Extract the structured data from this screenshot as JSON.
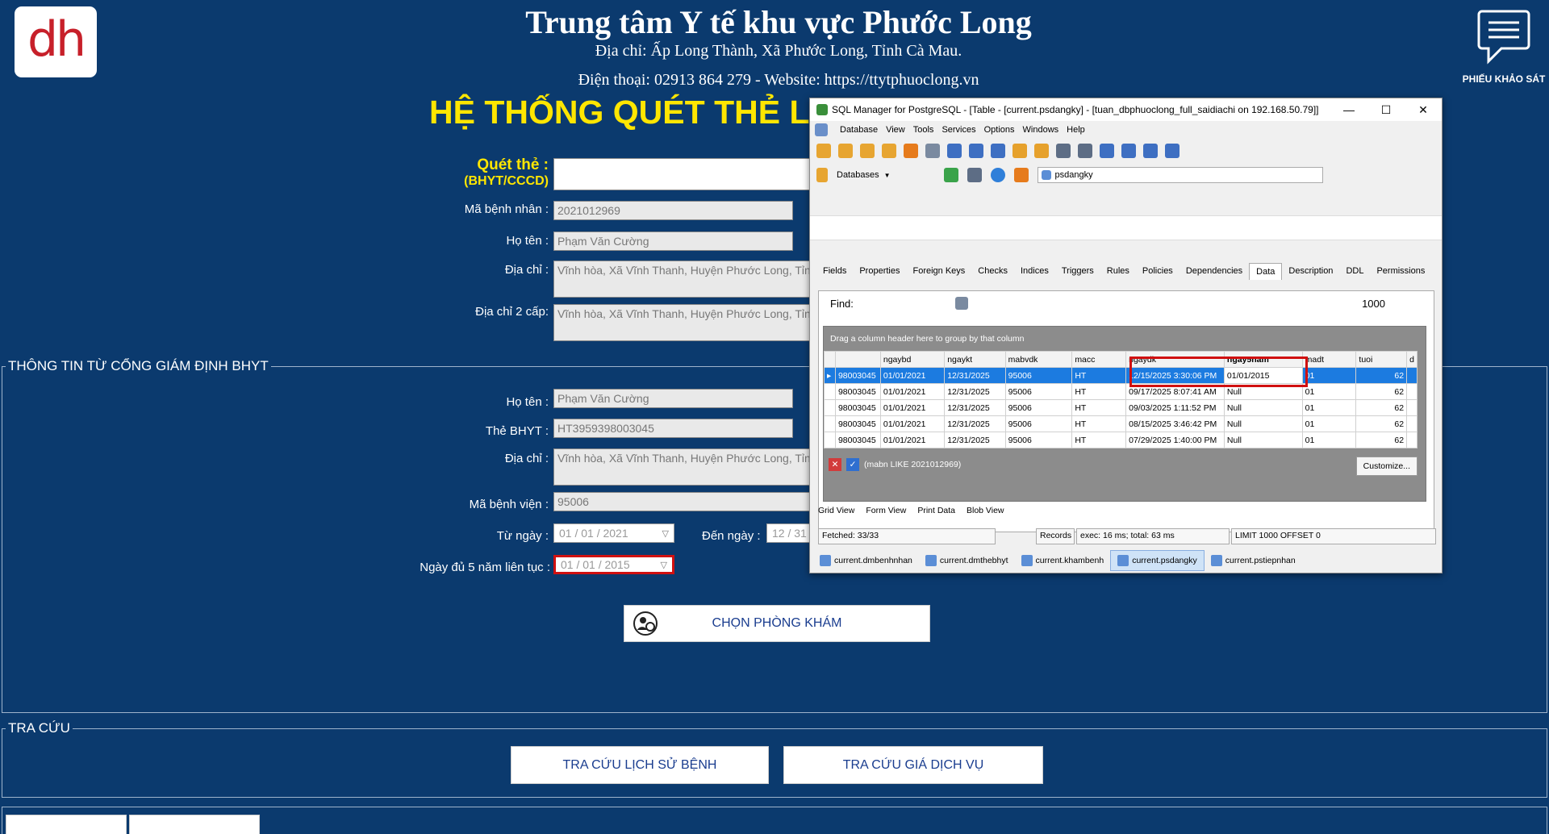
{
  "header": {
    "logo": "dh",
    "title": "Trung tâm Y tế khu vực Phước Long",
    "address": "Địa chỉ: Ấp Long Thành, Xã Phước Long, Tỉnh Cà Mau.",
    "phone": "Điện thoại: 02913 864 279 - Website: https://ttytphuoclong.vn",
    "system_title": "HỆ THỐNG QUÉT THẺ L",
    "survey": "PHIẾU KHẢO SÁT"
  },
  "form": {
    "scan_label": "Quét thẻ :",
    "scan_sub": "(BHYT/CCCD)",
    "scan_value": "",
    "patient_id_label": "Mã bệnh nhân :",
    "patient_id": "2021012969",
    "name_label": "Họ tên :",
    "name": "Phạm Văn Cường",
    "address_label": "Địa chỉ :",
    "address": "Vĩnh hòa, Xã Vĩnh Thanh, Huyện Phước Long, Tỉnh Bạ",
    "address2_label": "Địa chỉ 2 cấp:",
    "address2": "Vĩnh hòa, Xã Vĩnh Thanh, Huyện Phước Long, Tỉnh Bạ"
  },
  "bhyt": {
    "legend": "THÔNG TIN TỪ CỔNG GIÁM ĐỊNH BHYT",
    "name_label": "Họ tên :",
    "name": "Phạm Văn Cường",
    "card_label": "Thẻ BHYT :",
    "card": "HT3959398003045",
    "address_label": "Địa chỉ :",
    "address": "Vĩnh hòa, Xã Vĩnh Thanh, Huyện Phước Long, Tỉnh Bạ",
    "hospital_label": "Mã bệnh viện :",
    "hospital": "95006",
    "from_label": "Từ  ngày :",
    "from": "01 / 01 / 2021",
    "to_label": "Đến ngày :",
    "to": "12 / 31",
    "five_label": "Ngày đủ 5 năm liên tục :",
    "five": "01 / 01 / 2015",
    "choose_btn": "CHỌN PHÒNG KHÁM"
  },
  "lookup": {
    "legend": "TRA CỨU",
    "history_btn": "TRA CỨU LỊCH SỬ BỆNH",
    "price_btn": "TRA CỨU GIÁ DỊCH VỤ"
  },
  "sqlwin": {
    "title": "SQL Manager for PostgreSQL - [Table - [current.psdangky] - [tuan_dbphuoclong_full_saidiachi on 192.168.50.79]]",
    "menu": [
      "Database",
      "View",
      "Tools",
      "Services",
      "Options",
      "Windows",
      "Help"
    ],
    "databases_label": "Databases",
    "db_name": "psdangky",
    "tabs": [
      "Fields",
      "Properties",
      "Foreign Keys",
      "Checks",
      "Indices",
      "Triggers",
      "Rules",
      "Policies",
      "Dependencies",
      "Data",
      "Description",
      "DDL",
      "Permissions"
    ],
    "find_label": "Find:",
    "limit": "1000",
    "group_hint": "Drag a column header here to group by that column",
    "columns": [
      "",
      "ngaybd",
      "ngaykt",
      "mabvdk",
      "macc",
      "ngaydk",
      "ngay5nam",
      "madt",
      "tuoi",
      "d"
    ],
    "rows": [
      [
        "98003045",
        "01/01/2021",
        "12/31/2025",
        "95006",
        "HT",
        "12/15/2025 3:30:06 PM",
        "01/01/2015",
        "01",
        "62"
      ],
      [
        "98003045",
        "01/01/2021",
        "12/31/2025",
        "95006",
        "HT",
        "09/17/2025 8:07:41 AM",
        "Null",
        "01",
        "62"
      ],
      [
        "98003045",
        "01/01/2021",
        "12/31/2025",
        "95006",
        "HT",
        "09/03/2025 1:11:52 PM",
        "Null",
        "01",
        "62"
      ],
      [
        "98003045",
        "01/01/2021",
        "12/31/2025",
        "95006",
        "HT",
        "08/15/2025 3:46:42 PM",
        "Null",
        "01",
        "62"
      ],
      [
        "98003045",
        "01/01/2021",
        "12/31/2025",
        "95006",
        "HT",
        "07/29/2025 1:40:00 PM",
        "Null",
        "01",
        "62"
      ]
    ],
    "filter_text": "(mabn LIKE 2021012969)",
    "customize": "Customize...",
    "views": [
      "Grid View",
      "Form View",
      "Print Data",
      "Blob View"
    ],
    "status": {
      "fetched": "Fetched: 33/33",
      "records": "Records filte",
      "exec": "exec: 16 ms; total: 63 ms",
      "limit": "LIMIT 1000 OFFSET 0"
    },
    "bottom_tabs": [
      "current.dmbenhnhan",
      "current.dmthebhyt",
      "current.khambenh",
      "current.psdangky",
      "current.pstiepnhan"
    ]
  }
}
